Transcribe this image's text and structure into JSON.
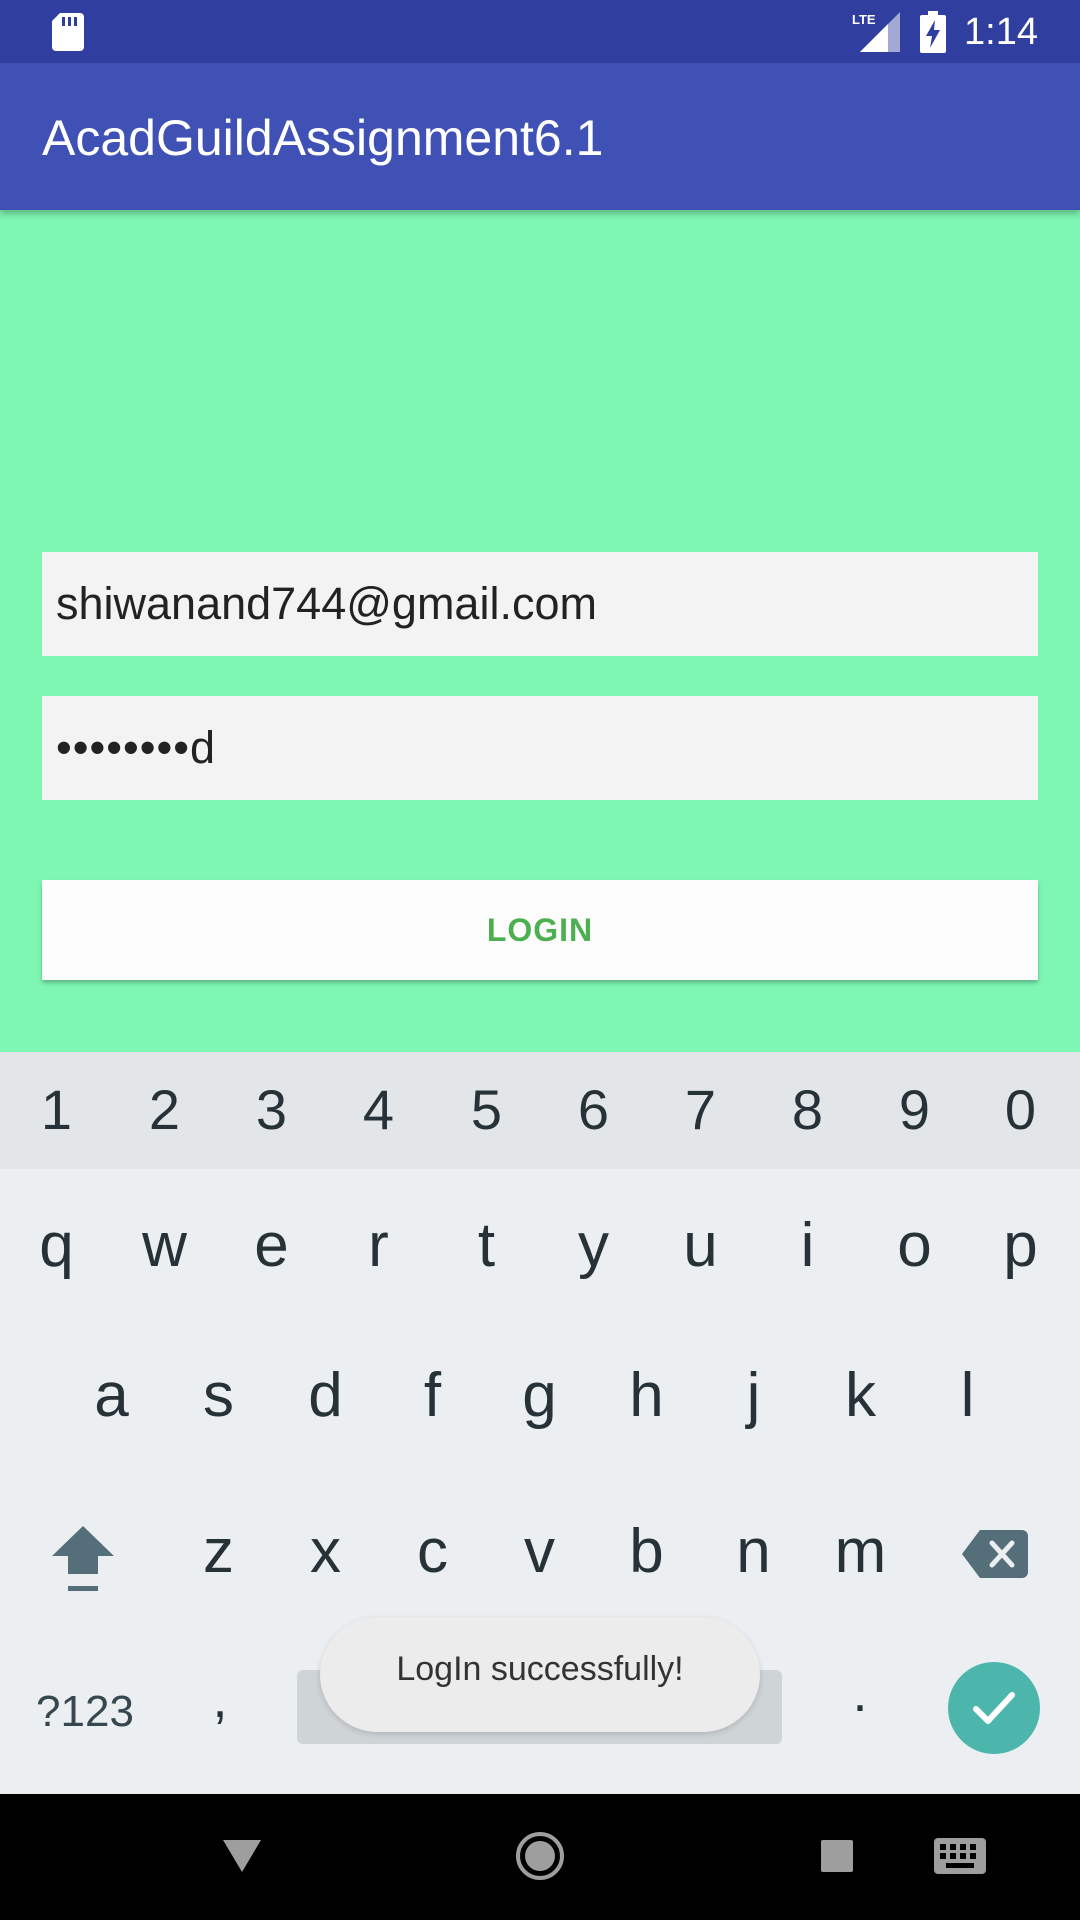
{
  "status_bar": {
    "time": "1:14",
    "network": "LTE",
    "icons": [
      "sd-card-icon",
      "signal-icon",
      "battery-charging-icon"
    ]
  },
  "app_bar": {
    "title": "AcadGuildAssignment6.1"
  },
  "form": {
    "email_value": "shiwanand744@gmail.com",
    "password_value": "••••••••d",
    "login_label": "LOGIN"
  },
  "keyboard": {
    "number_row": [
      "1",
      "2",
      "3",
      "4",
      "5",
      "6",
      "7",
      "8",
      "9",
      "0"
    ],
    "row1": [
      "q",
      "w",
      "e",
      "r",
      "t",
      "y",
      "u",
      "i",
      "o",
      "p"
    ],
    "row2": [
      "a",
      "s",
      "d",
      "f",
      "g",
      "h",
      "j",
      "k",
      "l"
    ],
    "row3": [
      "z",
      "x",
      "c",
      "v",
      "b",
      "n",
      "m"
    ],
    "symbols_label": "?123",
    "comma": ",",
    "period": "."
  },
  "toast": {
    "message": "LogIn successfully!"
  },
  "nav_bar": {
    "icons": [
      "back-icon",
      "home-icon",
      "recents-icon",
      "keyboard-switch-icon"
    ]
  },
  "colors": {
    "status_bar": "#303f9f",
    "app_bar": "#3f51b5",
    "content_background": "#7ef7b3",
    "login_text": "#4caf50",
    "enter_key": "#4db6ac"
  }
}
